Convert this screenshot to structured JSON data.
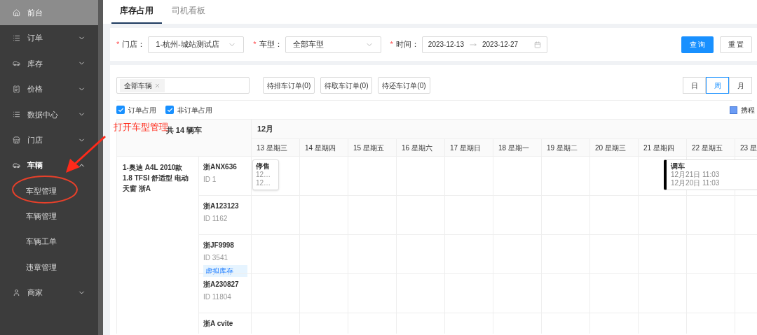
{
  "sidebar": {
    "items": [
      {
        "label": "前台",
        "selected": true,
        "expanded": false
      },
      {
        "label": "订单",
        "selected": false,
        "expanded": false
      },
      {
        "label": "库存",
        "selected": false,
        "expanded": false
      },
      {
        "label": "价格",
        "selected": false,
        "expanded": false
      },
      {
        "label": "数据中心",
        "selected": false,
        "expanded": false
      },
      {
        "label": "门店",
        "selected": false,
        "expanded": false
      },
      {
        "label": "车辆",
        "selected": false,
        "expanded": true,
        "children": [
          {
            "label": "车型管理"
          },
          {
            "label": "车辆管理"
          },
          {
            "label": "车辆工单"
          },
          {
            "label": "违章管理"
          }
        ]
      },
      {
        "label": "商家",
        "selected": false,
        "expanded": false
      }
    ]
  },
  "annotation": {
    "text": "打开车型管理"
  },
  "tabs": [
    {
      "label": "库存占用",
      "selected": true
    },
    {
      "label": "司机看板",
      "selected": false
    }
  ],
  "filters": [
    {
      "marker": "*",
      "label": "门店：",
      "kind": "select",
      "value": "1-杭州-城站测试店"
    },
    {
      "marker": "*",
      "label": "车型：",
      "kind": "select",
      "value": "全部车型"
    },
    {
      "marker": "*",
      "label": "时间：",
      "kind": "range",
      "from": "2023-12-13",
      "to": "2023-12-27"
    }
  ],
  "actions": [
    {
      "label": "查 询",
      "primary": true
    },
    {
      "label": "重 置",
      "primary": false
    }
  ],
  "vehicle_filter": {
    "tags": [
      "全部车辆"
    ]
  },
  "order_buttons": [
    "待排车订单(0)",
    "待取车订单(0)",
    "待还车订单(0)"
  ],
  "view_modes": [
    {
      "label": "日",
      "selected": false
    },
    {
      "label": "周",
      "selected": true
    },
    {
      "label": "月",
      "selected": false
    }
  ],
  "checks": [
    {
      "label": "订单占用",
      "checked": true
    },
    {
      "label": "非订单占用",
      "checked": true
    }
  ],
  "legend": [
    {
      "label": "携程",
      "color": "#6b9cf5"
    }
  ],
  "gantt": {
    "total": "共 14 辆车",
    "month": "12月",
    "days": [
      "13 星期三",
      "14 星期四",
      "15 星期五",
      "16 星期六",
      "17 星期日",
      "18 星期一",
      "19 星期二",
      "20 星期三",
      "21 星期四",
      "22 星期五",
      "23 星"
    ],
    "model": "1-奥迪 A4L 2010款 1.8 TFSI 舒适型 电动天窗 浙A",
    "rows": [
      {
        "plate": "浙ANX636",
        "id": "ID 1",
        "events": [
          {
            "kind": "plain",
            "title": "停售",
            "lines": [
              "12…",
              "12…"
            ]
          },
          {
            "kind": "marked",
            "title": "调车",
            "lines": [
              "12月21日 11:03",
              "12月20日 11:03"
            ]
          }
        ]
      },
      {
        "plate": "浙A123123",
        "id": "ID 1162"
      },
      {
        "plate": "浙JF9998",
        "id": "ID 3541",
        "tag": "虚拟库存"
      },
      {
        "plate": "浙A230827",
        "id": "ID 11804"
      },
      {
        "plate": "浙A cvite"
      }
    ]
  }
}
